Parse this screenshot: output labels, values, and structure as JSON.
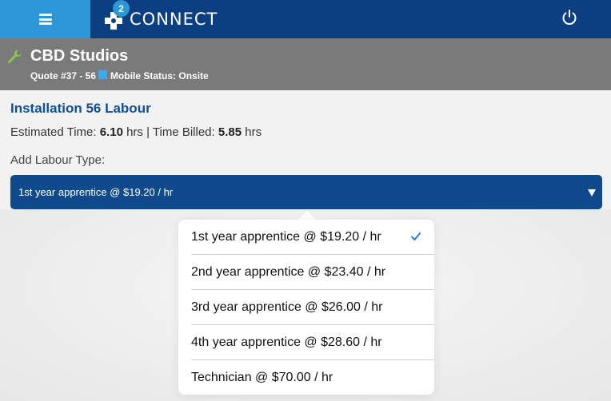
{
  "header": {
    "brand": "CONNECT",
    "badge_count": "2",
    "accent": "#2b97d8",
    "bar_color": "#0b3f82"
  },
  "job": {
    "client": "CBD Studios",
    "quote": "Quote #37 - 56",
    "mobile_status": "Mobile Status: Onsite",
    "status_color": "#40a9e8"
  },
  "labour": {
    "title": "Installation 56 Labour",
    "estimated_label": "Estimated Time:",
    "estimated_value": "6.10",
    "separator": "hrs | Time Billed:",
    "billed_value": "5.85",
    "unit": "hrs",
    "add_label": "Add Labour Type:",
    "selected": "1st year apprentice @ $19.20 / hr"
  },
  "options": [
    {
      "label": "1st year apprentice @ $19.20 / hr",
      "selected": true
    },
    {
      "label": "2nd year apprentice @ $23.40 / hr",
      "selected": false
    },
    {
      "label": "3rd year apprentice @ $26.00 / hr",
      "selected": false
    },
    {
      "label": "4th year apprentice @ $28.60 / hr",
      "selected": false
    },
    {
      "label": "Technician @ $70.00 / hr",
      "selected": false
    }
  ]
}
